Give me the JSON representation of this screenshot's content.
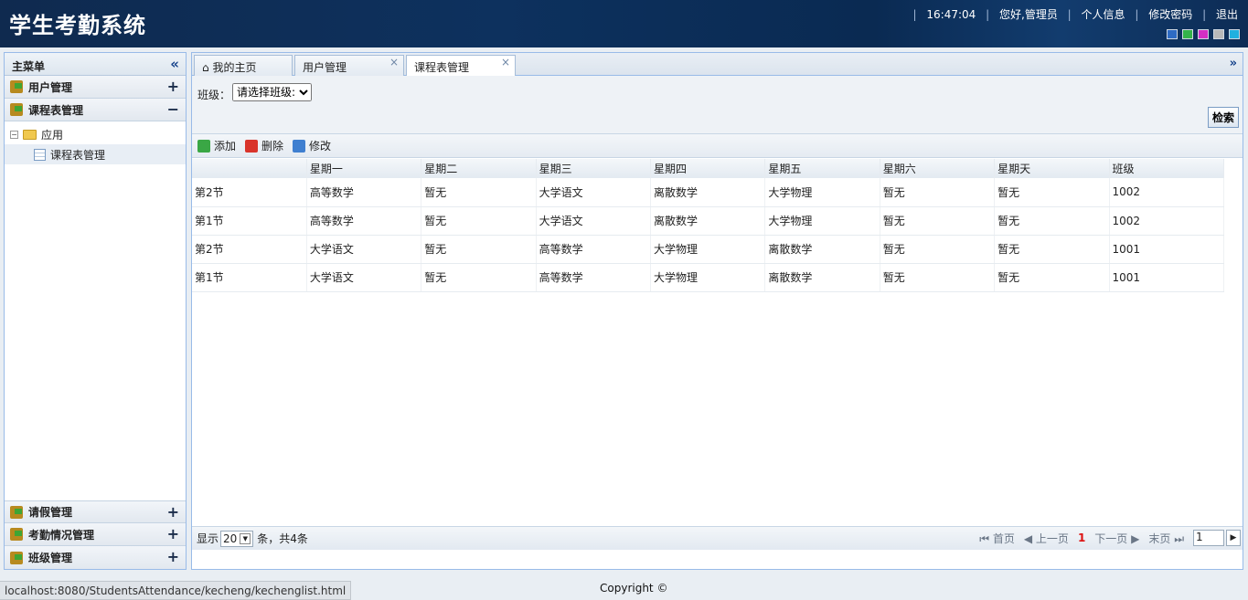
{
  "header": {
    "title": "学生考勤系统",
    "time": "16:47:04",
    "greeting": "您好,管理员",
    "profile": "个人信息",
    "change_password": "修改密码",
    "logout": "退出",
    "themes": [
      "#2e6bc4",
      "#34b34a",
      "#d42fc4",
      "#b9b9b9",
      "#20b0e0"
    ]
  },
  "sidebar": {
    "title": "主菜单",
    "menus": [
      {
        "label": "用户管理",
        "expanded": false
      },
      {
        "label": "课程表管理",
        "expanded": true
      }
    ],
    "tree": {
      "root": "应用",
      "child": "课程表管理"
    },
    "bottom_menus": [
      {
        "label": "请假管理"
      },
      {
        "label": "考勤情况管理"
      },
      {
        "label": "班级管理"
      }
    ]
  },
  "tabs": [
    {
      "label": "我的主页"
    },
    {
      "label": "用户管理"
    },
    {
      "label": "课程表管理"
    }
  ],
  "search": {
    "label": "班级：",
    "select_value": "请选择班级:",
    "button": "检索"
  },
  "toolbar": {
    "add": "添加",
    "delete": "删除",
    "edit": "修改"
  },
  "table": {
    "columns": [
      "",
      "星期一",
      "星期二",
      "星期三",
      "星期四",
      "星期五",
      "星期六",
      "星期天",
      "班级"
    ],
    "rows": [
      [
        "第2节",
        "高等数学",
        "暂无",
        "大学语文",
        "离散数学",
        "大学物理",
        "暂无",
        "暂无",
        "1002"
      ],
      [
        "第1节",
        "高等数学",
        "暂无",
        "大学语文",
        "离散数学",
        "大学物理",
        "暂无",
        "暂无",
        "1002"
      ],
      [
        "第2节",
        "大学语文",
        "暂无",
        "高等数学",
        "大学物理",
        "离散数学",
        "暂无",
        "暂无",
        "1001"
      ],
      [
        "第1节",
        "大学语文",
        "暂无",
        "高等数学",
        "大学物理",
        "离散数学",
        "暂无",
        "暂无",
        "1001"
      ]
    ]
  },
  "pager": {
    "show": "显示",
    "page_size": "20",
    "summary": "条，共4条",
    "first": "首页",
    "prev": "上一页",
    "current": "1",
    "next": "下一页",
    "last": "末页",
    "page_input": "1"
  },
  "statusbar": "localhost:8080/StudentsAttendance/kecheng/kechenglist.html",
  "footer": "Copyright ©"
}
